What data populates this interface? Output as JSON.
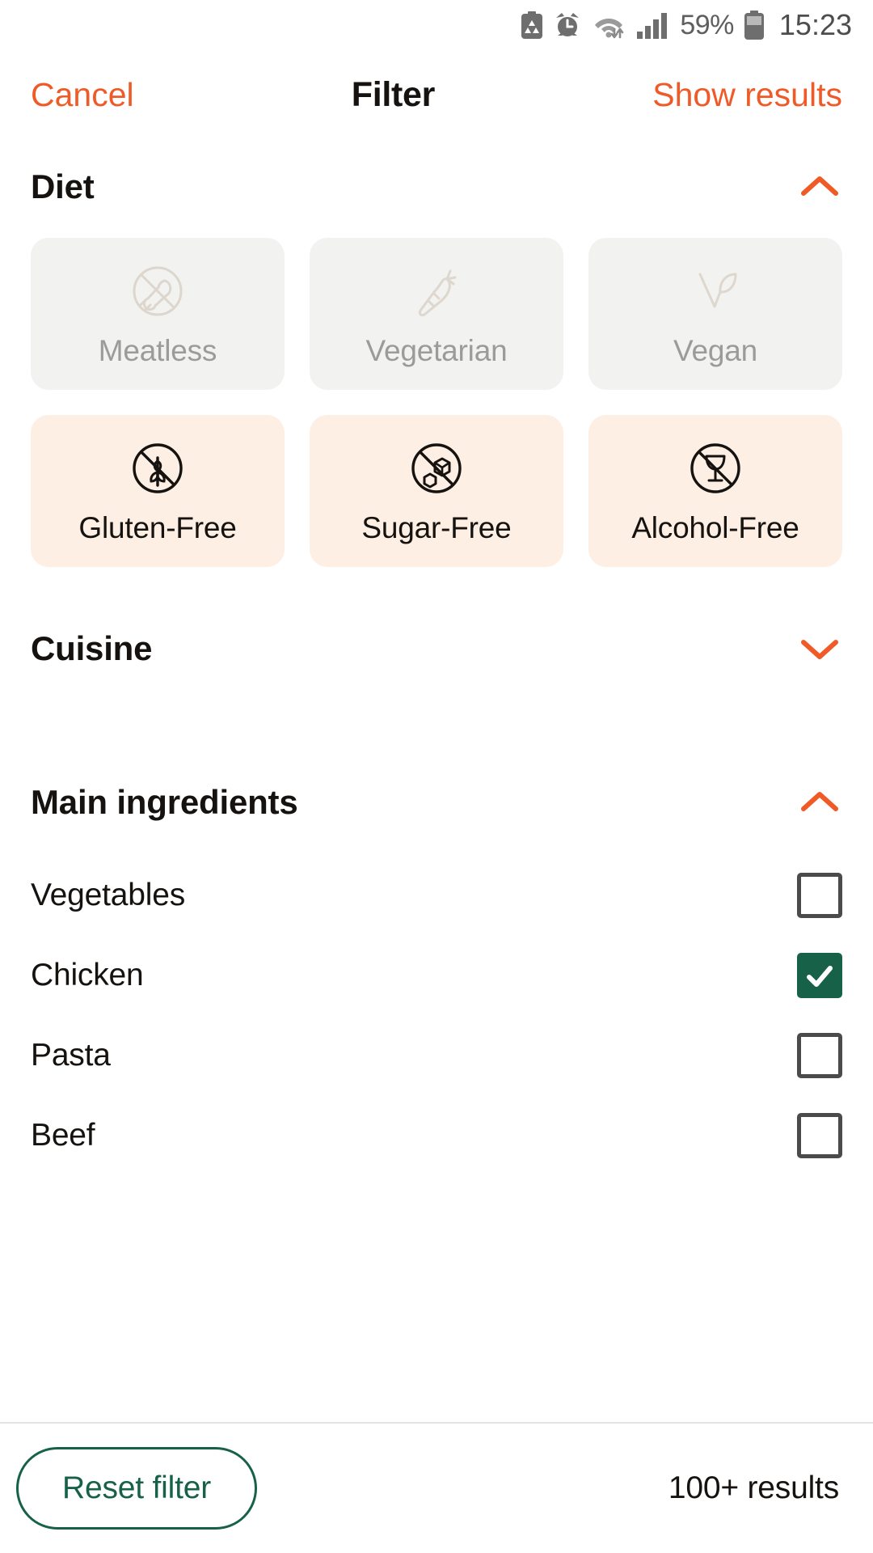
{
  "status_bar": {
    "battery_percent": "59%",
    "time": "15:23",
    "icons": [
      "battery-saver-icon",
      "alarm-icon",
      "wifi-icon",
      "signal-icon",
      "battery-icon"
    ]
  },
  "header": {
    "cancel_label": "Cancel",
    "title": "Filter",
    "show_results_label": "Show results"
  },
  "colors": {
    "accent_orange": "#ef5a26",
    "chip_selected_bg": "#fdefe3",
    "chip_disabled_bg": "#f2f2f0",
    "checkbox_checked": "#166148",
    "text_primary": "#15120f",
    "text_muted": "#9b9b99"
  },
  "sections": [
    {
      "id": "diet",
      "title": "Diet",
      "expanded": true,
      "chevron": "chevron-up-icon",
      "chips": [
        {
          "label": "Meatless",
          "icon": "no-meat-icon",
          "state": "disabled"
        },
        {
          "label": "Vegetarian",
          "icon": "carrot-icon",
          "state": "disabled"
        },
        {
          "label": "Vegan",
          "icon": "leaf-icon",
          "state": "disabled"
        },
        {
          "label": "Gluten-Free",
          "icon": "no-gluten-icon",
          "state": "selected"
        },
        {
          "label": "Sugar-Free",
          "icon": "no-sugar-icon",
          "state": "selected"
        },
        {
          "label": "Alcohol-Free",
          "icon": "no-alcohol-icon",
          "state": "selected"
        }
      ]
    },
    {
      "id": "cuisine",
      "title": "Cuisine",
      "expanded": false,
      "chevron": "chevron-down-icon"
    },
    {
      "id": "main-ingredients",
      "title": "Main ingredients",
      "expanded": true,
      "chevron": "chevron-up-icon",
      "items": [
        {
          "label": "Vegetables",
          "checked": false
        },
        {
          "label": "Chicken",
          "checked": true
        },
        {
          "label": "Pasta",
          "checked": false
        },
        {
          "label": "Beef",
          "checked": false
        }
      ]
    }
  ],
  "footer": {
    "reset_label": "Reset filter",
    "results_label": "100+ results"
  }
}
